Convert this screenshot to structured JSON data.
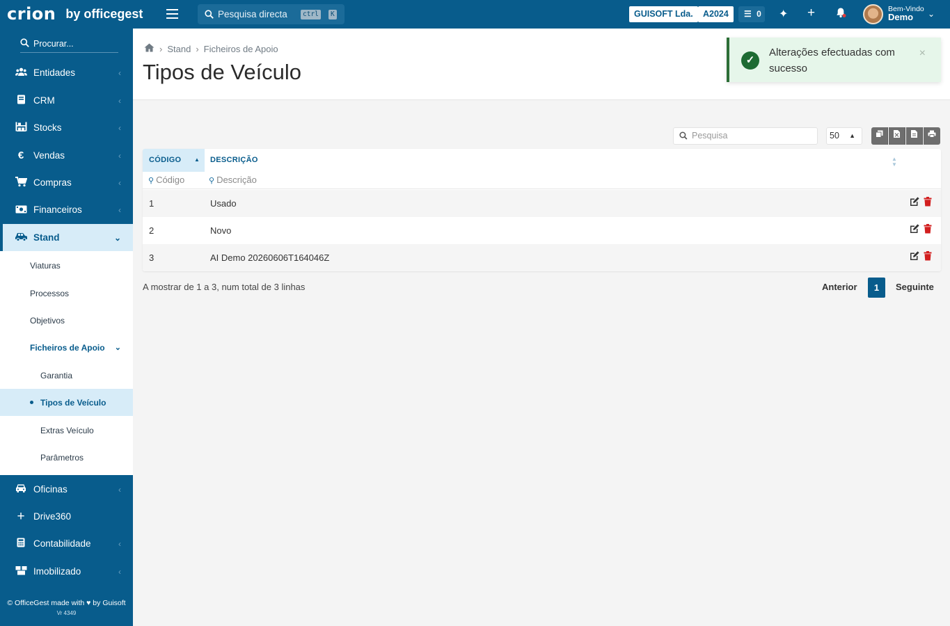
{
  "topbar": {
    "brand": "crion",
    "brand_suffix": "by officegest",
    "search_placeholder": "Pesquisa directa",
    "kbd1": "ctrl",
    "kbd2": "K",
    "company": "GUISOFT Lda.",
    "year": "A2024",
    "tasks_count": "0",
    "welcome_line1": "Bem-Vindo",
    "welcome_line2": "Demo"
  },
  "sidebar": {
    "search_placeholder": "Procurar...",
    "items": [
      {
        "label": "Entidades",
        "icon": "users-icon"
      },
      {
        "label": "CRM",
        "icon": "book-icon"
      },
      {
        "label": "Stocks",
        "icon": "warehouse-icon"
      },
      {
        "label": "Vendas",
        "icon": "euro-icon"
      },
      {
        "label": "Compras",
        "icon": "cart-icon"
      },
      {
        "label": "Financeiros",
        "icon": "money-icon"
      },
      {
        "label": "Stand",
        "icon": "car-icon"
      }
    ],
    "stand_sub": [
      "Viaturas",
      "Processos",
      "Objetivos",
      "Ficheiros de Apoio"
    ],
    "apoio_sub": [
      "Garantia",
      "Tipos de Veículo",
      "Extras Veículo",
      "Parâmetros"
    ],
    "items2": [
      {
        "label": "Oficinas",
        "icon": "car-icon"
      },
      {
        "label": "Drive360",
        "icon": "plus-icon"
      },
      {
        "label": "Contabilidade",
        "icon": "calculator-icon"
      },
      {
        "label": "Imobilizado",
        "icon": "boxes-icon"
      }
    ],
    "footer_text": "© OfficeGest made with ♥ by Guisoft",
    "version": "Vr 4349"
  },
  "breadcrumb": {
    "items": [
      "Stand",
      "Ficheiros de Apoio"
    ]
  },
  "page_title": "Tipos de Veículo",
  "toast": {
    "message": "Alterações efectuadas com sucesso",
    "close": "×"
  },
  "table_tools": {
    "search_placeholder": "Pesquisa",
    "page_size": "50"
  },
  "table": {
    "columns": [
      "CÓDIGO",
      "DESCRIÇÃO"
    ],
    "filter_placeholders": [
      "Código",
      "Descrição"
    ],
    "rows": [
      {
        "code": "1",
        "desc": "Usado"
      },
      {
        "code": "2",
        "desc": "Novo"
      },
      {
        "code": "3",
        "desc": "AI Demo 20260606T164046Z"
      }
    ]
  },
  "footer": {
    "summary": "A mostrar de 1 a 3, num total de 3 linhas",
    "prev": "Anterior",
    "current_page": "1",
    "next": "Seguinte"
  },
  "colors": {
    "primary": "#085c8c",
    "highlight": "#d7ecf8",
    "success": "#1e6b33",
    "danger": "#d21f1f"
  }
}
